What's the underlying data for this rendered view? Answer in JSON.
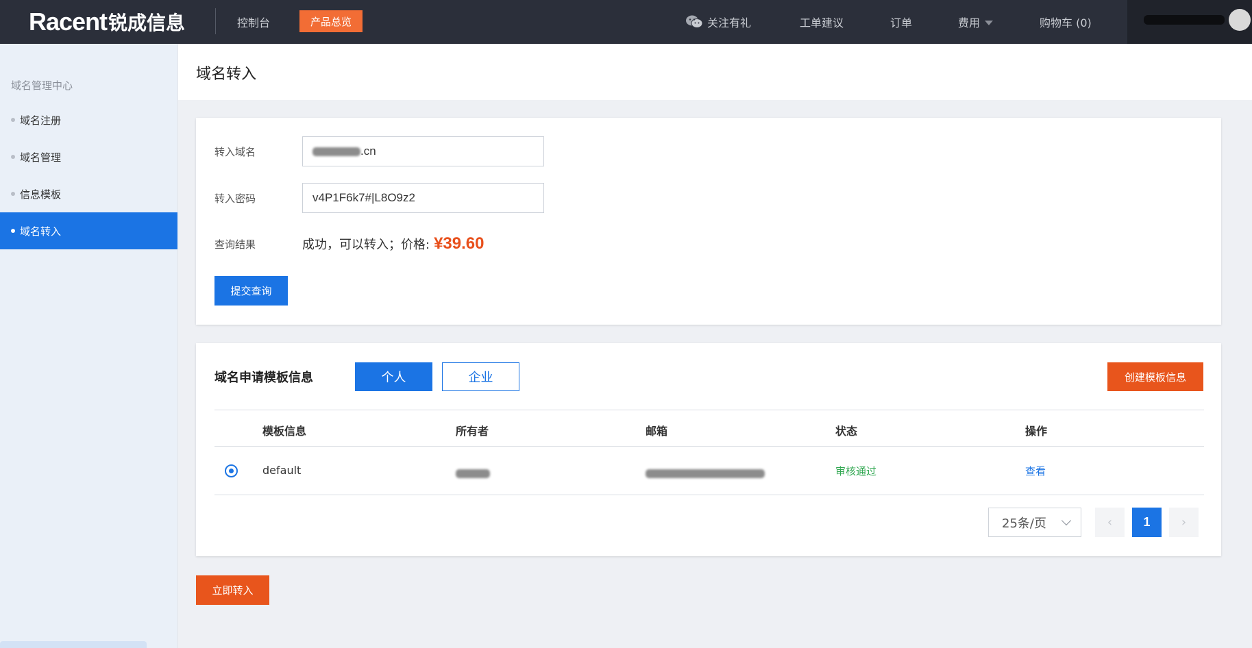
{
  "header": {
    "logo_text_latin": "Racent",
    "logo_text_cn": "锐成信息",
    "console_label": "控制台",
    "products_label": "产品总览",
    "follow_label": "关注有礼",
    "ticket_label": "工单建议",
    "orders_label": "订单",
    "fees_label": "费用",
    "cart_label": "购物车 (0)",
    "accent_color": "#f26d35"
  },
  "sidebar": {
    "heading": "域名管理中心",
    "items": [
      {
        "label": "域名注册",
        "active": false
      },
      {
        "label": "域名管理",
        "active": false
      },
      {
        "label": "信息模板",
        "active": false
      },
      {
        "label": "域名转入",
        "active": true
      }
    ]
  },
  "page": {
    "title": "域名转入"
  },
  "query_form": {
    "domain_label": "转入域名",
    "domain_value_suffix": ".cn",
    "password_label": "转入密码",
    "password_value": "v4P1F6k7#|L8O9z2",
    "result_label": "查询结果",
    "result_text": "成功，可以转入；价格:",
    "price": "¥39.60",
    "submit_label": "提交查询"
  },
  "template_section": {
    "title": "域名申请模板信息",
    "tab_personal": "个人",
    "tab_company": "企业",
    "create_label": "创建模板信息",
    "columns": [
      "模板信息",
      "所有者",
      "邮箱",
      "状态",
      "操作"
    ],
    "rows": [
      {
        "template": "default",
        "owner": "",
        "email": "",
        "status": "审核通过",
        "action": "查看",
        "selected": true
      }
    ],
    "page_size": "25条/页",
    "current_page": "1",
    "prev_symbol": "‹",
    "next_symbol": "›"
  },
  "transfer_button_label": "立即转入"
}
